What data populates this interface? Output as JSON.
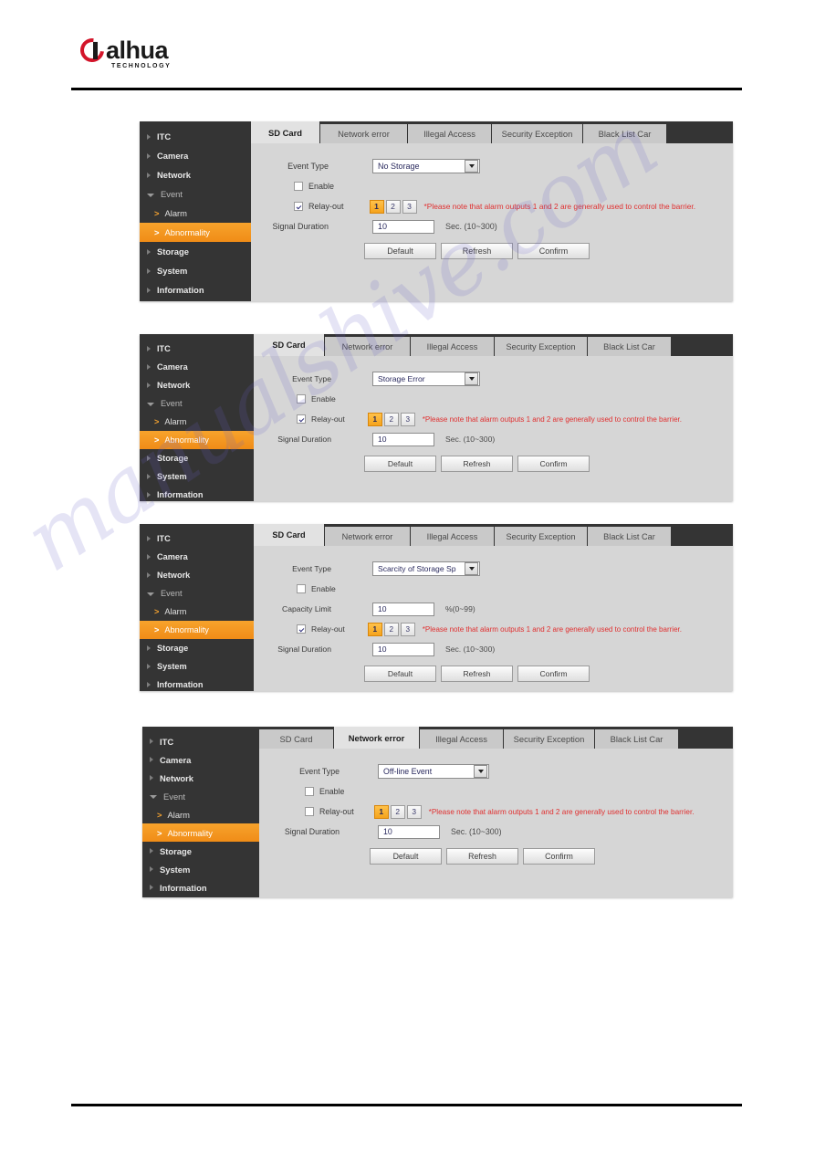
{
  "brand": {
    "name": "alhua",
    "tagline": "TECHNOLOGY"
  },
  "watermark": "manualshive.com",
  "sidebar": {
    "items": [
      {
        "label": "ITC",
        "type": "top",
        "state": "collapsed"
      },
      {
        "label": "Camera",
        "type": "top",
        "state": "collapsed"
      },
      {
        "label": "Network",
        "type": "top",
        "state": "collapsed"
      },
      {
        "label": "Event",
        "type": "top",
        "state": "expanded"
      },
      {
        "label": "Alarm",
        "type": "sub",
        "state": "normal"
      },
      {
        "label": "Abnormality",
        "type": "sub",
        "state": "active"
      },
      {
        "label": "Storage",
        "type": "top",
        "state": "collapsed"
      },
      {
        "label": "System",
        "type": "top",
        "state": "collapsed"
      },
      {
        "label": "Information",
        "type": "top",
        "state": "collapsed"
      }
    ],
    "chevron": ">"
  },
  "tabs": [
    {
      "label": "SD Card"
    },
    {
      "label": "Network error"
    },
    {
      "label": "Illegal Access"
    },
    {
      "label": "Security Exception"
    },
    {
      "label": "Black List Car"
    }
  ],
  "labels": {
    "event_type": "Event Type",
    "enable": "Enable",
    "relay_out": "Relay-out",
    "signal_duration": "Signal Duration",
    "capacity_limit": "Capacity Limit",
    "sec_hint": "Sec. (10~300)",
    "percent_hint": "%(0~99)",
    "warning": "*Please note that alarm outputs 1 and 2 are generally used to control the barrier."
  },
  "buttons": {
    "default": "Default",
    "refresh": "Refresh",
    "confirm": "Confirm"
  },
  "relay_outputs": [
    "1",
    "2",
    "3"
  ],
  "colors": {
    "accent_orange": "#f5a31c",
    "warning_red": "#e03030",
    "sidebar_bg": "#343434",
    "panel_bg": "#d6d6d6",
    "brand_red": "#d3152a"
  },
  "panels": [
    {
      "id": "panel-sd-no-storage",
      "active_tab": "SD Card",
      "event_type_value": "No Storage",
      "enable_checked": false,
      "relay_checked": true,
      "relay_active": "1",
      "capacity_limit_visible": false,
      "capacity_limit_value": "",
      "signal_duration_value": "10"
    },
    {
      "id": "panel-sd-storage-error",
      "active_tab": "SD Card",
      "event_type_value": "Storage Error",
      "enable_checked": false,
      "relay_checked": true,
      "relay_active": "1",
      "capacity_limit_visible": false,
      "capacity_limit_value": "",
      "signal_duration_value": "10"
    },
    {
      "id": "panel-sd-scarcity",
      "active_tab": "SD Card",
      "event_type_value": "Scarcity of Storage Sp",
      "enable_checked": false,
      "relay_checked": true,
      "relay_active": "1",
      "capacity_limit_visible": true,
      "capacity_limit_value": "10",
      "signal_duration_value": "10"
    },
    {
      "id": "panel-network-offline",
      "active_tab": "Network error",
      "event_type_value": "Off-line Event",
      "enable_checked": false,
      "relay_checked": false,
      "relay_active": "1",
      "capacity_limit_visible": false,
      "capacity_limit_value": "",
      "signal_duration_value": "10"
    }
  ]
}
